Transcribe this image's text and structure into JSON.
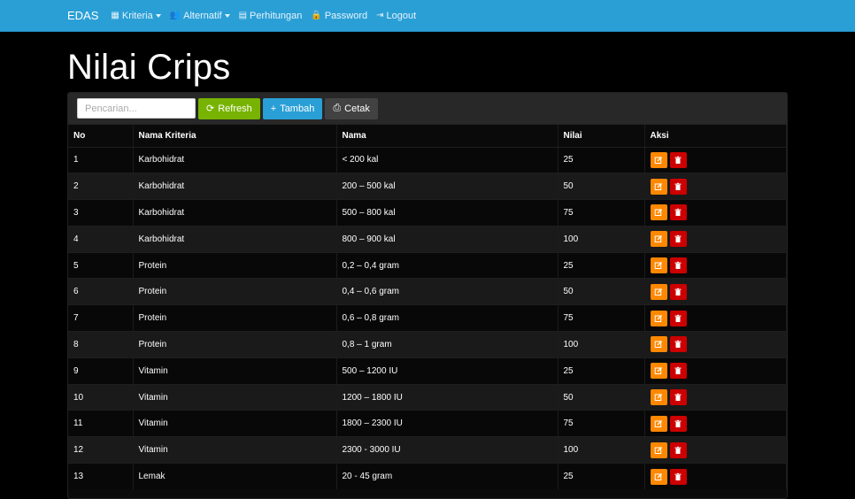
{
  "nav": {
    "brand": "EDAS",
    "items": [
      {
        "label": "Kriteria",
        "icon": "table-icon",
        "dropdown": true
      },
      {
        "label": "Alternatif",
        "icon": "users-icon",
        "dropdown": true
      },
      {
        "label": "Perhitungan",
        "icon": "calendar-icon",
        "dropdown": false
      },
      {
        "label": "Password",
        "icon": "lock-icon",
        "dropdown": false
      },
      {
        "label": "Logout",
        "icon": "sign-out-icon",
        "dropdown": false
      }
    ]
  },
  "page": {
    "title": "Nilai Crips"
  },
  "toolbar": {
    "search_placeholder": "Pencarian...",
    "refresh_label": "Refresh",
    "add_label": "Tambah",
    "print_label": "Cetak"
  },
  "table": {
    "headers": [
      "No",
      "Nama Kriteria",
      "Nama",
      "Nilai",
      "Aksi"
    ],
    "rows": [
      [
        "1",
        "Karbohidrat",
        "< 200 kal",
        "25"
      ],
      [
        "2",
        "Karbohidrat",
        "200 – 500 kal",
        "50"
      ],
      [
        "3",
        "Karbohidrat",
        "500 – 800 kal",
        "75"
      ],
      [
        "4",
        "Karbohidrat",
        "800 – 900 kal",
        "100"
      ],
      [
        "5",
        "Protein",
        "0,2 – 0,4 gram",
        "25"
      ],
      [
        "6",
        "Protein",
        "0,4 – 0,6 gram",
        "50"
      ],
      [
        "7",
        "Protein",
        "0,6 – 0,8 gram",
        "75"
      ],
      [
        "8",
        "Protein",
        "0,8 – 1 gram",
        "100"
      ],
      [
        "9",
        "Vitamin",
        "500 – 1200 IU",
        "25"
      ],
      [
        "10",
        "Vitamin",
        "1200 – 1800 IU",
        "50"
      ],
      [
        "11",
        "Vitamin",
        "1800 – 2300 IU",
        "75"
      ],
      [
        "12",
        "Vitamin",
        "2300 - 3000 IU",
        "100"
      ],
      [
        "13",
        "Lemak",
        "20 - 45 gram",
        "25"
      ]
    ]
  },
  "colors": {
    "navbar": "#2a9fd6",
    "refresh": "#77b300",
    "add": "#2a9fd6",
    "print": "#424242",
    "edit": "#ff8800",
    "delete": "#cc0000"
  }
}
